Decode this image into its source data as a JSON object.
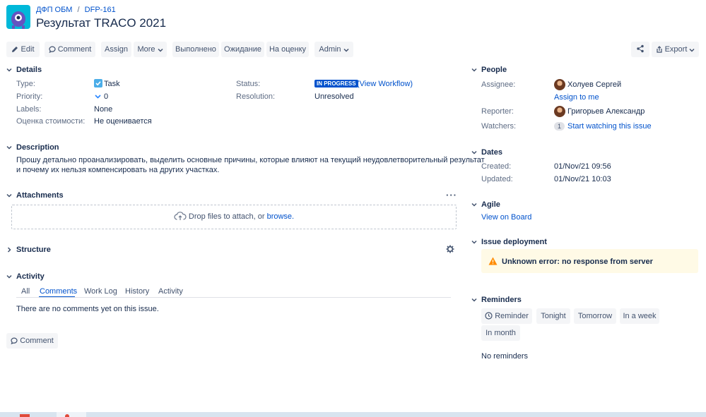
{
  "breadcrumb": {
    "project": "ДФП ОБМ",
    "separator": "/",
    "issue_key": "DFP-161"
  },
  "issue": {
    "title": "Результат TRACO 2021"
  },
  "toolbar": {
    "edit": "Edit",
    "comment": "Comment",
    "assign": "Assign",
    "more": "More",
    "done": "Выполнено",
    "waiting": "Ожидание",
    "review": "На оценку",
    "admin": "Admin",
    "export": "Export"
  },
  "details": {
    "title": "Details",
    "type_label": "Type:",
    "type_value": "Task",
    "priority_label": "Priority:",
    "priority_value": "0",
    "labels_label": "Labels:",
    "labels_value": "None",
    "estimate_label": "Оценка стоимости:",
    "estimate_value": "Не оценивается",
    "status_label": "Status:",
    "status_badge": "IN PROGRESS",
    "view_workflow": "(View Workflow)",
    "resolution_label": "Resolution:",
    "resolution_value": "Unresolved"
  },
  "description": {
    "title": "Description",
    "line1": "Прошу детально проанализировать, выделить основные причины, которые влияют на текущий неудовлетворительный результат",
    "line2": "и почему их нельзя компенсировать на других участках."
  },
  "attachments": {
    "title": "Attachments",
    "drop_text": "Drop files to attach, or",
    "browse": "browse."
  },
  "structure": {
    "title": "Structure"
  },
  "activity": {
    "title": "Activity",
    "tabs": [
      "All",
      "Comments",
      "Work Log",
      "History",
      "Activity"
    ],
    "active_tab": "Comments",
    "empty": "There are no comments yet on this issue.",
    "comment_button": "Comment"
  },
  "people": {
    "title": "People",
    "assignee_label": "Assignee:",
    "assignee_name": "Холуев Сергей",
    "assign_to_me": "Assign to me",
    "reporter_label": "Reporter:",
    "reporter_name": "Григорьев Александр",
    "watchers_label": "Watchers:",
    "watchers_count": "1",
    "start_watching": "Start watching this issue"
  },
  "dates": {
    "title": "Dates",
    "created_label": "Created:",
    "created_value": "01/Nov/21 09:56",
    "updated_label": "Updated:",
    "updated_value": "01/Nov/21 10:03"
  },
  "agile": {
    "title": "Agile",
    "view_on_board": "View on Board"
  },
  "deployment": {
    "title": "Issue deployment",
    "error": "Unknown error: no response from server"
  },
  "reminders": {
    "title": "Reminders",
    "buttons": [
      "Reminder",
      "Tonight",
      "Tomorrow",
      "In a week",
      "In month"
    ],
    "empty": "No reminders"
  },
  "colors": {
    "accent": "#0052cc",
    "status_badge": "#0052cc",
    "warning_bg": "#fffae6",
    "warning_icon": "#ff8b00",
    "avatar_bg": "#00b8d9"
  }
}
